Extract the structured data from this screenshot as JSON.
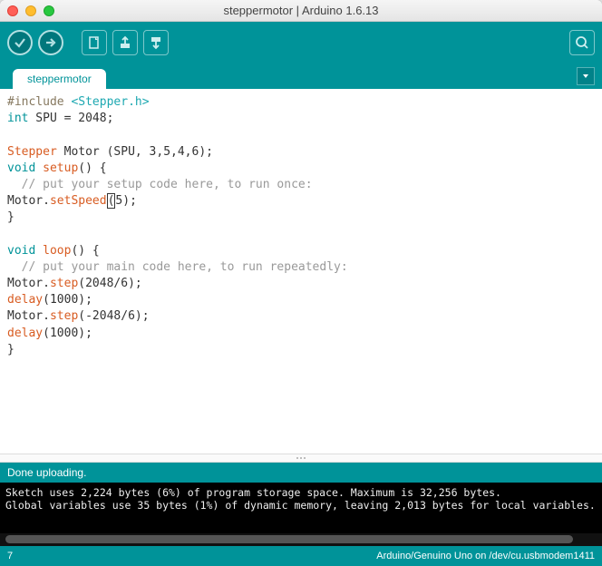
{
  "window": {
    "title": "steppermotor | Arduino 1.6.13"
  },
  "tabs": [
    {
      "label": "steppermotor"
    }
  ],
  "code": {
    "line1_pre": "#include",
    "line1_inc": " <Stepper.h>",
    "line2_type": "int",
    "line2_rest": " SPU = 2048;",
    "line4_class": "Stepper",
    "line4_rest": " Motor (SPU, 3,5,4,6);",
    "line5_void": "void",
    "line5_fn": " setup",
    "line5_rest": "() {",
    "line6_comment": "  // put your setup code here, to run once:",
    "line7_obj": "Motor.",
    "line7_call": "setSpeed",
    "line7_open": "(",
    "line7_arg": "5",
    "line7_close": ");",
    "line8": "}",
    "line10_void": "void",
    "line10_fn": " loop",
    "line10_rest": "() {",
    "line11_comment": "  // put your main code here, to run repeatedly:",
    "line12_obj": "Motor.",
    "line12_call": "step",
    "line12_rest": "(2048/6);",
    "line13_call": "delay",
    "line13_rest": "(1000);",
    "line14_obj": "Motor.",
    "line14_call": "step",
    "line14_rest": "(-2048/6);",
    "line15_call": "delay",
    "line15_rest": "(1000);",
    "line16": "}"
  },
  "status": {
    "message": "Done uploading."
  },
  "console": {
    "line1": "Sketch uses 2,224 bytes (6%) of program storage space. Maximum is 32,256 bytes.",
    "line2": "Global variables use 35 bytes (1%) of dynamic memory, leaving 2,013 bytes for local variables."
  },
  "footer": {
    "line": "7",
    "board": "Arduino/Genuino Uno on /dev/cu.usbmodem1411"
  }
}
